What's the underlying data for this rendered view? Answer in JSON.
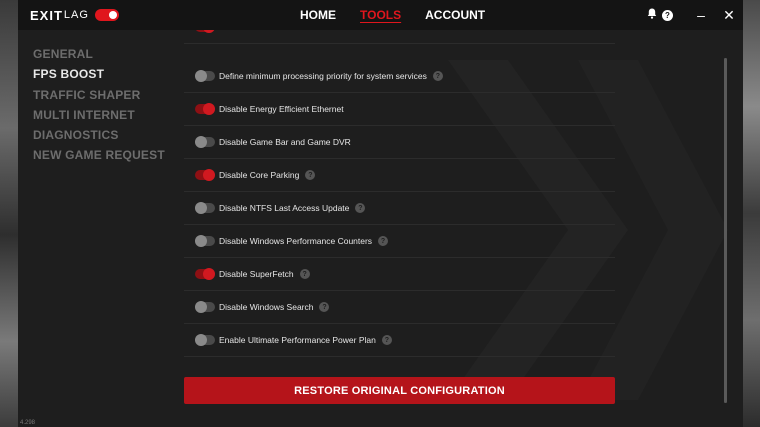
{
  "app": {
    "logo_text_bold": "EXIT",
    "logo_text_light": "LAG",
    "version": "4.298"
  },
  "nav": {
    "items": [
      {
        "label": "HOME",
        "active": false
      },
      {
        "label": "TOOLS",
        "active": true
      },
      {
        "label": "ACCOUNT",
        "active": false
      }
    ]
  },
  "titlebar": {
    "bell_icon": "bell-icon",
    "help_icon": "?",
    "minimize_label": "–",
    "close_label": "✕"
  },
  "sidebar": {
    "items": [
      {
        "label": "GENERAL",
        "active": false
      },
      {
        "label": "FPS BOOST",
        "active": true
      },
      {
        "label": "TRAFFIC SHAPER",
        "active": false
      },
      {
        "label": "MULTI INTERNET",
        "active": false
      },
      {
        "label": "DIAGNOSTICS",
        "active": false
      },
      {
        "label": "NEW GAME REQUEST",
        "active": false
      }
    ]
  },
  "options": [
    {
      "label": "Define minimum processing priority for system services",
      "enabled": false,
      "help": true
    },
    {
      "label": "Disable Energy Efficient Ethernet",
      "enabled": true,
      "help": false
    },
    {
      "label": "Disable Game Bar and Game DVR",
      "enabled": false,
      "help": false
    },
    {
      "label": "Disable Core Parking",
      "enabled": true,
      "help": true
    },
    {
      "label": "Disable NTFS Last Access Update",
      "enabled": false,
      "help": true
    },
    {
      "label": "Disable Windows Performance Counters",
      "enabled": false,
      "help": true
    },
    {
      "label": "Disable SuperFetch",
      "enabled": true,
      "help": true
    },
    {
      "label": "Disable Windows Search",
      "enabled": false,
      "help": true
    },
    {
      "label": "Enable Ultimate Performance Power Plan",
      "enabled": false,
      "help": true
    }
  ],
  "help_glyph": "?",
  "restore_button": "RESTORE ORIGINAL CONFIGURATION",
  "colors": {
    "accent": "#e0161d",
    "background": "#1e1e1e",
    "titlebar": "#141414"
  }
}
